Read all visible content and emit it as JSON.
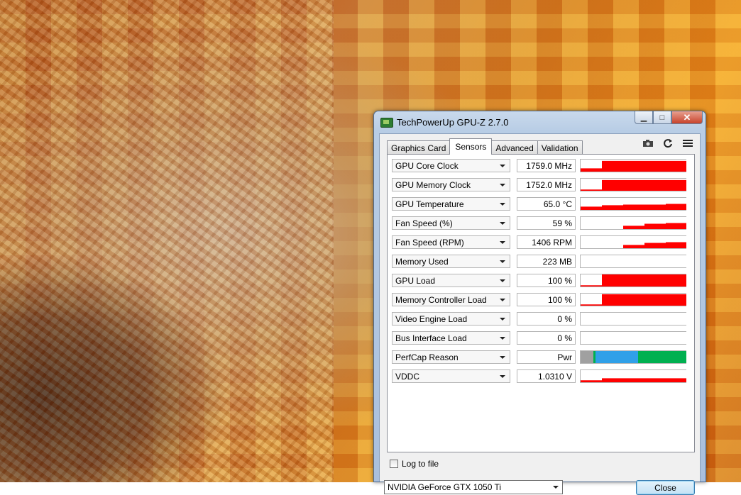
{
  "window": {
    "title": "TechPowerUp GPU-Z 2.7.0"
  },
  "tabs": [
    "Graphics Card",
    "Sensors",
    "Advanced",
    "Validation"
  ],
  "active_tab": "Sensors",
  "toolbar": {
    "icons": [
      "camera-icon",
      "refresh-icon",
      "menu-icon"
    ]
  },
  "colors": {
    "graph": "#ff0000",
    "perfcap_gray": "#a0a0a0",
    "perfcap_green": "#00b050",
    "perfcap_blue": "#30a0e8"
  },
  "sensors": [
    {
      "label": "GPU Core Clock",
      "value": "1759.0 MHz",
      "graph": [
        0.35,
        0.9,
        0.9,
        0.9,
        0.9
      ]
    },
    {
      "label": "GPU Memory Clock",
      "value": "1752.0 MHz",
      "graph": [
        0.2,
        0.9,
        0.9,
        0.9,
        0.9
      ]
    },
    {
      "label": "GPU Temperature",
      "value": "65.0 °C",
      "graph": [
        0.35,
        0.45,
        0.5,
        0.5,
        0.55
      ]
    },
    {
      "label": "Fan Speed (%)",
      "value": "59 %",
      "graph": [
        0.0,
        0.0,
        0.35,
        0.5,
        0.55
      ]
    },
    {
      "label": "Fan Speed (RPM)",
      "value": "1406 RPM",
      "graph": [
        0.0,
        0.0,
        0.35,
        0.5,
        0.55
      ]
    },
    {
      "label": "Memory Used",
      "value": "223 MB",
      "graph": [
        0.05,
        0.05,
        0.05,
        0.05,
        0.05
      ]
    },
    {
      "label": "GPU Load",
      "value": "100 %",
      "graph": [
        0.2,
        1.0,
        1.0,
        1.0,
        1.0
      ]
    },
    {
      "label": "Memory Controller Load",
      "value": "100 %",
      "graph": [
        0.2,
        0.95,
        0.95,
        0.95,
        0.95
      ]
    },
    {
      "label": "Video Engine Load",
      "value": "0 %",
      "graph": [
        0,
        0,
        0,
        0,
        0
      ]
    },
    {
      "label": "Bus Interface Load",
      "value": "0 %",
      "graph": [
        0,
        0,
        0,
        0,
        0
      ]
    },
    {
      "label": "PerfCap Reason",
      "value": "Pwr",
      "perfcap": [
        {
          "reason": "gray",
          "share": 0.12
        },
        {
          "reason": "green-edge",
          "share": 0.02
        },
        {
          "reason": "blue",
          "share": 0.4
        },
        {
          "reason": "green",
          "share": 0.46
        }
      ]
    },
    {
      "label": "VDDC",
      "value": "1.0310 V",
      "graph": [
        0.25,
        0.4,
        0.4,
        0.4,
        0.4
      ]
    }
  ],
  "log": {
    "label": "Log to file",
    "checked": false
  },
  "gpu_select": {
    "value": "NVIDIA GeForce GTX 1050 Ti"
  },
  "buttons": {
    "close": "Close"
  }
}
